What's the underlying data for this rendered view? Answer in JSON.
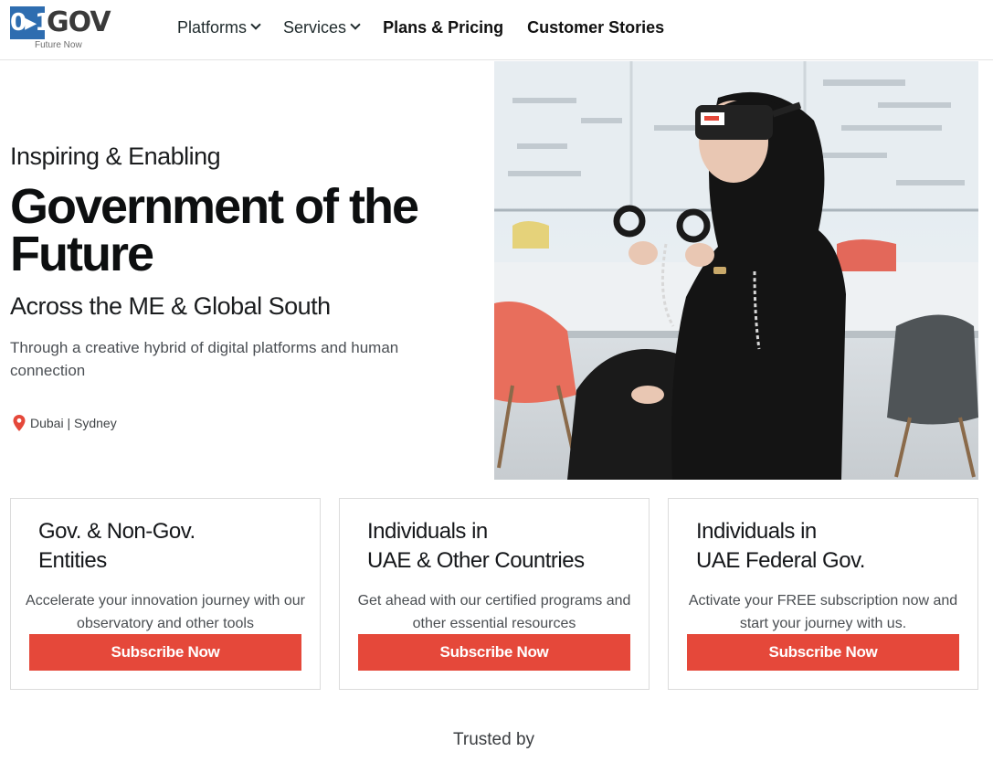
{
  "brand": {
    "logo_mark": "0▸1",
    "logo_text": "GOV",
    "tagline": "Future Now"
  },
  "nav": {
    "items": [
      {
        "label": "Platforms",
        "has_dropdown": true
      },
      {
        "label": "Services",
        "has_dropdown": true
      },
      {
        "label": "Plans & Pricing",
        "has_dropdown": false
      },
      {
        "label": "Customer Stories",
        "has_dropdown": false
      }
    ]
  },
  "hero": {
    "eyebrow": "Inspiring & Enabling",
    "title": "Government of the Future",
    "subtitle": "Across the ME & Global South",
    "description": "Through a creative hybrid of digital platforms and human connection",
    "location": "Dubai | Sydney",
    "image_icon": "vr-headset-photo"
  },
  "cards": [
    {
      "title_line1": "Gov. & Non-Gov.",
      "title_line2": "Entities",
      "description": "Accelerate your innovation journey with our observatory and other tools",
      "button": "Subscribe Now"
    },
    {
      "title_line1": "Individuals in",
      "title_line2": "UAE & Other Countries",
      "description": "Get ahead with our certified programs and other essential resources",
      "button": "Subscribe Now"
    },
    {
      "title_line1": "Individuals in",
      "title_line2": "UAE Federal Gov.",
      "description": "Activate your FREE subscription now and start your journey with us.",
      "button": "Subscribe Now"
    }
  ],
  "trusted_by": "Trusted by",
  "colors": {
    "accent": "#e5483a",
    "brand_blue": "#2e6db0",
    "text_dark": "#0d0f10"
  }
}
